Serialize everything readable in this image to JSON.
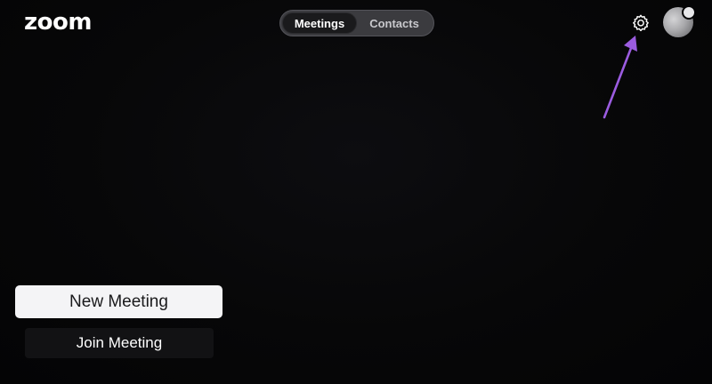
{
  "app": {
    "logo_text": "zoom"
  },
  "tabs": [
    {
      "label": "Meetings",
      "active": true
    },
    {
      "label": "Contacts",
      "active": false
    }
  ],
  "header": {
    "settings_icon": "gear-icon",
    "avatar_icon": "avatar"
  },
  "actions": {
    "new_meeting_label": "New Meeting",
    "join_meeting_label": "Join Meeting"
  },
  "annotation": {
    "arrow_color": "#9b5ce0"
  },
  "colors": {
    "background": "#050506",
    "segment_bg": "#3b3b3f",
    "primary_button_bg": "#f4f4f6",
    "secondary_button_bg": "#121214"
  }
}
